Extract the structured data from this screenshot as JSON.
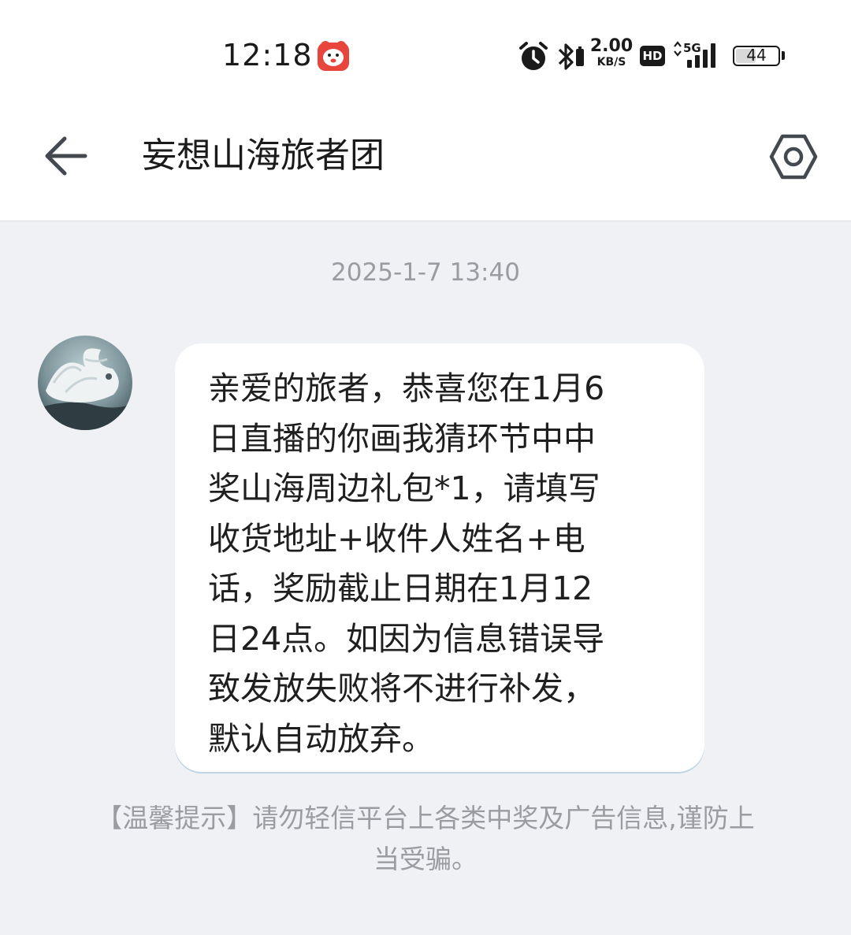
{
  "status_bar": {
    "time": "12:18",
    "net_speed_value": "2.00",
    "net_speed_unit": "KB/S",
    "hd_label": "HD",
    "network_label": "5G",
    "battery_level": "44",
    "icons": [
      "app-notification-icon",
      "alarm-icon",
      "bluetooth-icon",
      "hd-icon",
      "signal-5g-icon",
      "battery-icon"
    ]
  },
  "header": {
    "title": "妄想山海旅者团",
    "back_icon": "back-arrow-icon",
    "settings_icon": "settings-hexagon-icon"
  },
  "conversation": {
    "timestamp": "2025-1-7 13:40",
    "message": {
      "text": "亲爱的旅者，恭喜您在1月6\n日直播的你画我猜环节中中\n奖山海周边礼包*1，请填写\n收货地址+收件人姓名+电\n话，奖励截止日期在1月12\n日24点。如因为信息错误导\n致发放失败将不进行补发，\n默认自动放弃。"
    },
    "tip_line1": "【温馨提示】请勿轻信平台上各类中奖及广告信息,谨防上",
    "tip_line2": "当受骗。"
  },
  "colors": {
    "background": "#f0f1f4",
    "header_bg": "#ffffff",
    "bubble_bg": "#ffffff",
    "muted_text": "#9a9ca1",
    "app_icon_red": "#e8453c"
  }
}
